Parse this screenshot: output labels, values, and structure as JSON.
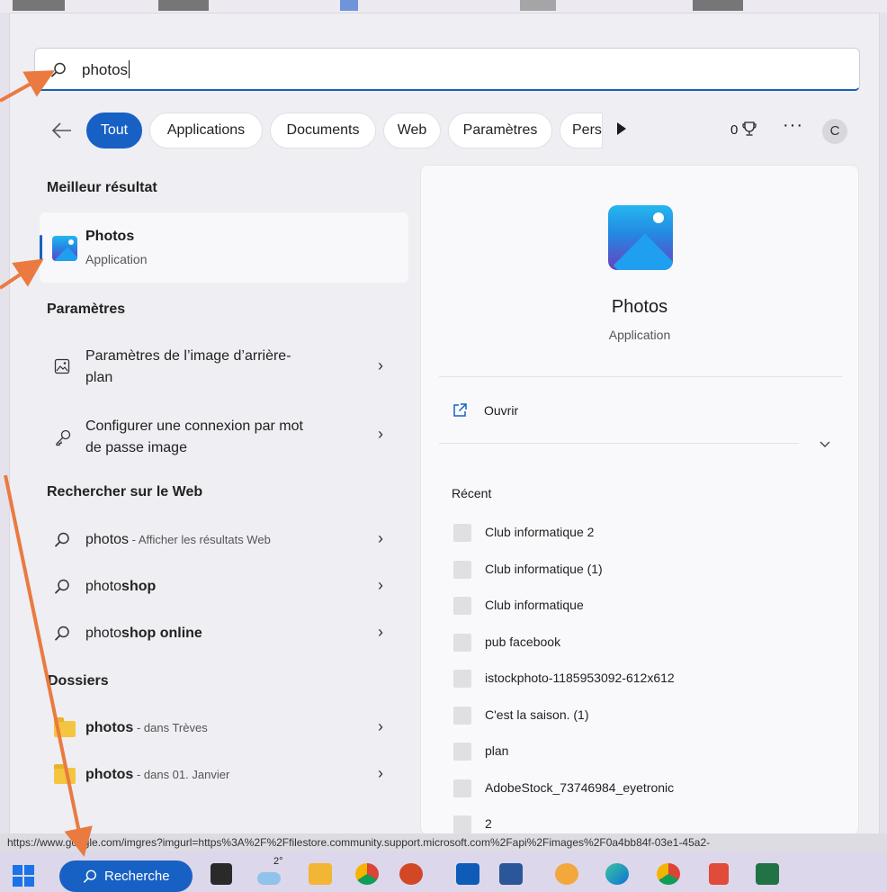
{
  "search": {
    "value": "photos"
  },
  "filters": {
    "tabs": [
      {
        "label": "Tout"
      },
      {
        "label": "Applications"
      },
      {
        "label": "Documents"
      },
      {
        "label": "Web"
      },
      {
        "label": "Paramètres"
      },
      {
        "label": "Pers"
      }
    ],
    "points": "0",
    "account_initial": "C"
  },
  "left": {
    "best_header": "Meilleur résultat",
    "best": {
      "title": "Photos",
      "subtitle": "Application"
    },
    "settings_header": "Paramètres",
    "settings": [
      {
        "line1": "Paramètres de l’image d’arrière-",
        "line2": "plan"
      },
      {
        "line1": "Configurer une connexion par mot",
        "line2": "de passe image"
      }
    ],
    "web_header": "Rechercher sur le Web",
    "web": [
      {
        "prefix": "photos",
        "suffix": " - Afficher les résultats Web"
      },
      {
        "prefix": "photo",
        "suffix": "shop"
      },
      {
        "prefix": "photo",
        "suffix": "shop online"
      }
    ],
    "folders_header": "Dossiers",
    "folders": [
      {
        "name": "photos",
        "location": " - dans Trèves"
      },
      {
        "name": "photos",
        "location": " - dans 01. Janvier"
      }
    ]
  },
  "preview": {
    "title": "Photos",
    "subtitle": "Application",
    "open_label": "Ouvrir",
    "recent_header": "Récent",
    "recent": [
      "Club informatique 2",
      "Club informatique (1)",
      "Club informatique",
      "pub facebook",
      "istockphoto-1185953092-612x612",
      "C'est la saison. (1)",
      "plan",
      "AdobeStock_73746984_eyetronic",
      "2"
    ]
  },
  "status_url": "https://www.google.com/imgres?imgurl=https%3A%2F%2Ffilestore.community.support.microsoft.com%2Fapi%2Fimages%2F0a4bb84f-03e1-45a2-",
  "taskbar": {
    "search_label": "Recherche",
    "weather_temp": "2°"
  },
  "colors": {
    "accent": "#1861c4",
    "annotation": "#ea7a3f"
  }
}
